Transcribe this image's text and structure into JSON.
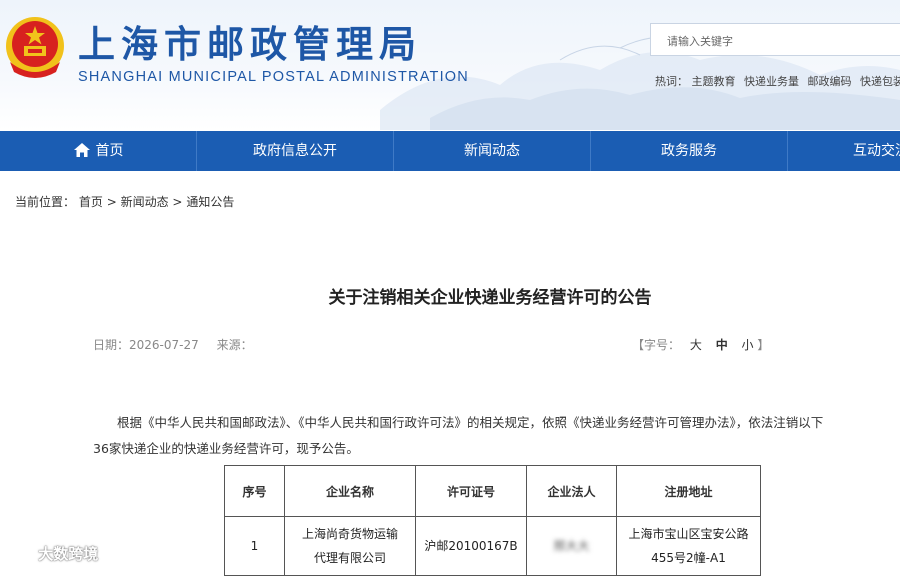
{
  "header": {
    "site_title": "上海市邮政管理局",
    "site_subtitle": "SHANGHAI MUNICIPAL POSTAL ADMINISTRATION",
    "search_placeholder": "请输入关键字",
    "hot_label": "热词：",
    "hot_words": [
      "主题教育",
      "快递业务量",
      "邮政编码",
      "快递包装"
    ]
  },
  "nav": {
    "items": [
      "首页",
      "政府信息公开",
      "新闻动态",
      "政务服务",
      "互动交流"
    ]
  },
  "breadcrumb": {
    "label": "当前位置：",
    "items": [
      "首页",
      "新闻动态",
      "通知公告"
    ],
    "separator": ">"
  },
  "article": {
    "title": "关于注销相关企业快递业务经营许可的公告",
    "date": "日期：2026-07-27",
    "source": "来源：",
    "font_size": {
      "open": "【字号：",
      "large": "大",
      "medium": "中",
      "small": "小",
      "close": "】"
    },
    "paragraph_line1": "根据《中华人民共和国邮政法》、《中华人民共和国行政许可法》的相关规定，依照《快递业务经营许可管理办法》，依法注销以下",
    "paragraph_line2": "36家快递企业的快递业务经营许可，现予公告。"
  },
  "table": {
    "headers": [
      "序号",
      "企业名称",
      "许可证号",
      "企业法人",
      "注册地址"
    ],
    "rows": [
      {
        "index": "1",
        "name_line1": "上海尚奇货物运输",
        "name_line2": "代理有限公司",
        "license": "沪邮20100167B",
        "legal_person": "邢大大",
        "address_line1": "上海市宝山区宝安公路",
        "address_line2": "455号2幢-A1"
      }
    ]
  },
  "watermark": "大数跨境",
  "colors": {
    "brand_blue": "#1e57a6",
    "nav_bg": "#1b5db3",
    "emblem_red": "#d7211f",
    "emblem_gold": "#f1c21b"
  }
}
